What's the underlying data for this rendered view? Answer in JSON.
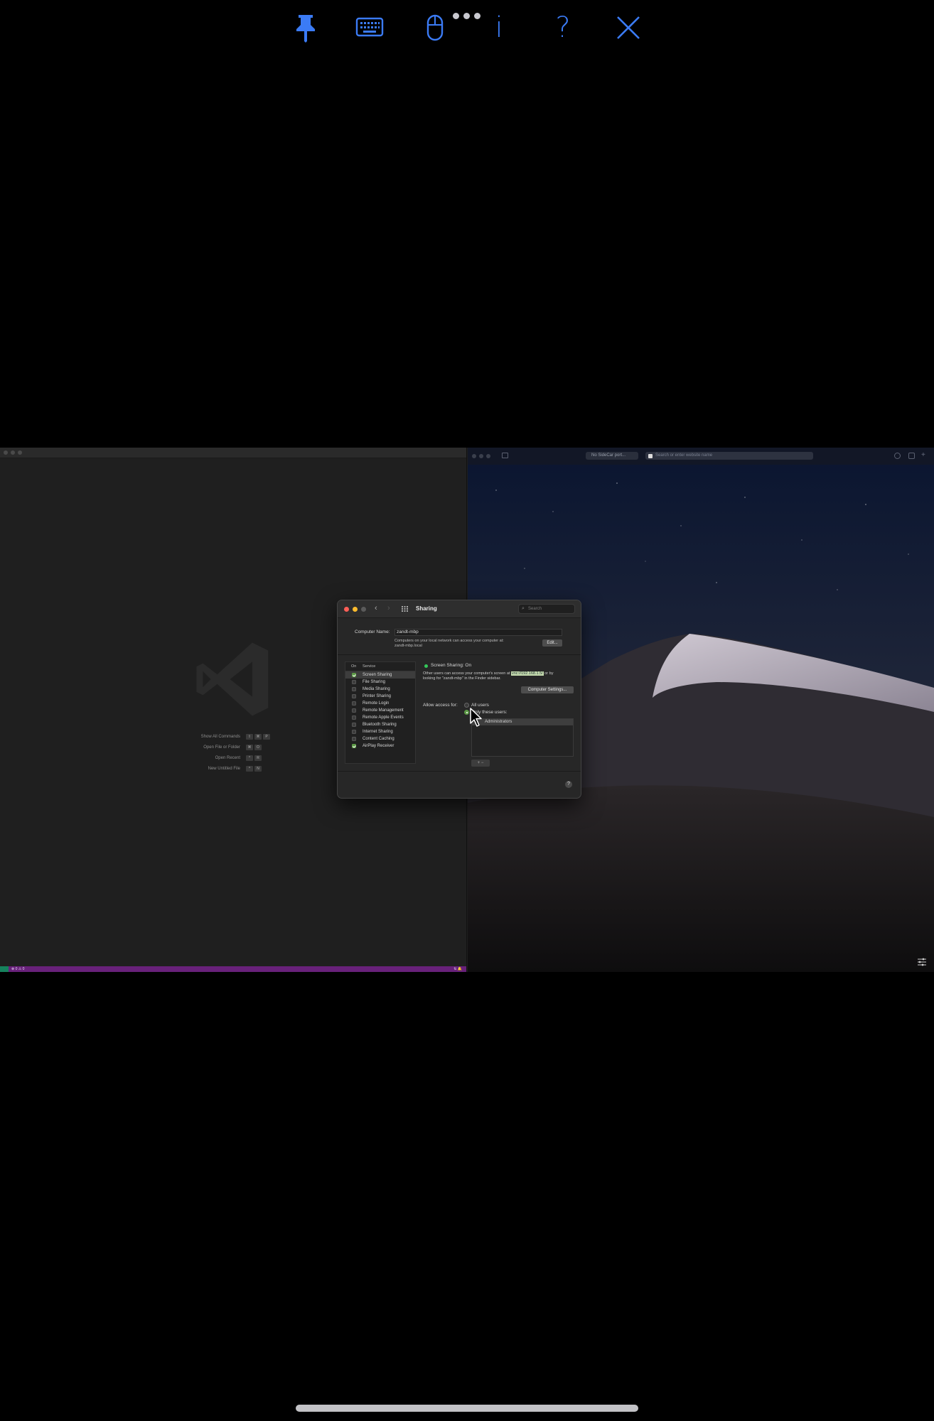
{
  "toolbar": {
    "buttons": [
      {
        "id": "pin",
        "icon": "pin-icon"
      },
      {
        "id": "keyboard",
        "icon": "keyboard-icon"
      },
      {
        "id": "mouse",
        "icon": "mouse-icon"
      },
      {
        "id": "info",
        "icon": "info-icon",
        "label": "i"
      },
      {
        "id": "help",
        "icon": "help-icon",
        "label": "?"
      },
      {
        "id": "close",
        "icon": "close-icon"
      }
    ],
    "accent": "#3b7bf5"
  },
  "vscode": {
    "commands": [
      {
        "label": "Show All Commands",
        "keys": [
          "⇧",
          "⌘",
          "P"
        ]
      },
      {
        "label": "Open File or Folder",
        "keys": [
          "⌘",
          "O"
        ]
      },
      {
        "label": "Open Recent",
        "keys": [
          "^",
          "R"
        ]
      },
      {
        "label": "New Untitled File",
        "keys": [
          "^",
          "N"
        ]
      }
    ],
    "status_left": "⊗ 0 ⚠ 0",
    "status_right": "⇅ 🔔",
    "status_color": "#68217a"
  },
  "safari": {
    "tab_label": "No SideCar port...",
    "url_placeholder": "Search or enter website name"
  },
  "sharing": {
    "title": "Sharing",
    "search_placeholder": "Search",
    "computer_name_label": "Computer Name:",
    "computer_name": "zandt-mbp",
    "local_network_note": "Computers on your local network can access your computer at:",
    "local_address": "zandt-mbp.local",
    "edit_label": "Edit...",
    "col_on": "On",
    "col_service": "Service",
    "services": [
      {
        "name": "Screen Sharing",
        "on": true,
        "selected": true
      },
      {
        "name": "File Sharing",
        "on": false
      },
      {
        "name": "Media Sharing",
        "on": false
      },
      {
        "name": "Printer Sharing",
        "on": false
      },
      {
        "name": "Remote Login",
        "on": false
      },
      {
        "name": "Remote Management",
        "on": false
      },
      {
        "name": "Remote Apple Events",
        "on": false
      },
      {
        "name": "Bluetooth Sharing",
        "on": false
      },
      {
        "name": "Internet Sharing",
        "on": false
      },
      {
        "name": "Content Caching",
        "on": false
      },
      {
        "name": "AirPlay Receiver",
        "on": true
      }
    ],
    "status": "Screen Sharing: On",
    "status_color": "#34c759",
    "description_a": "Other users can access your computer's screen at",
    "vnc_address": "vnc://192.168.1.5/",
    "description_b": "or by",
    "description_c": "looking for \"zandt-mbp\" in the Finder sidebar.",
    "computer_settings_label": "Computer Settings...",
    "allow_access_label": "Allow access for:",
    "all_users_label": "All users",
    "only_these_label": "Only these users:",
    "users": [
      "Administrators"
    ],
    "add_remove": "+   −",
    "help": "?"
  }
}
